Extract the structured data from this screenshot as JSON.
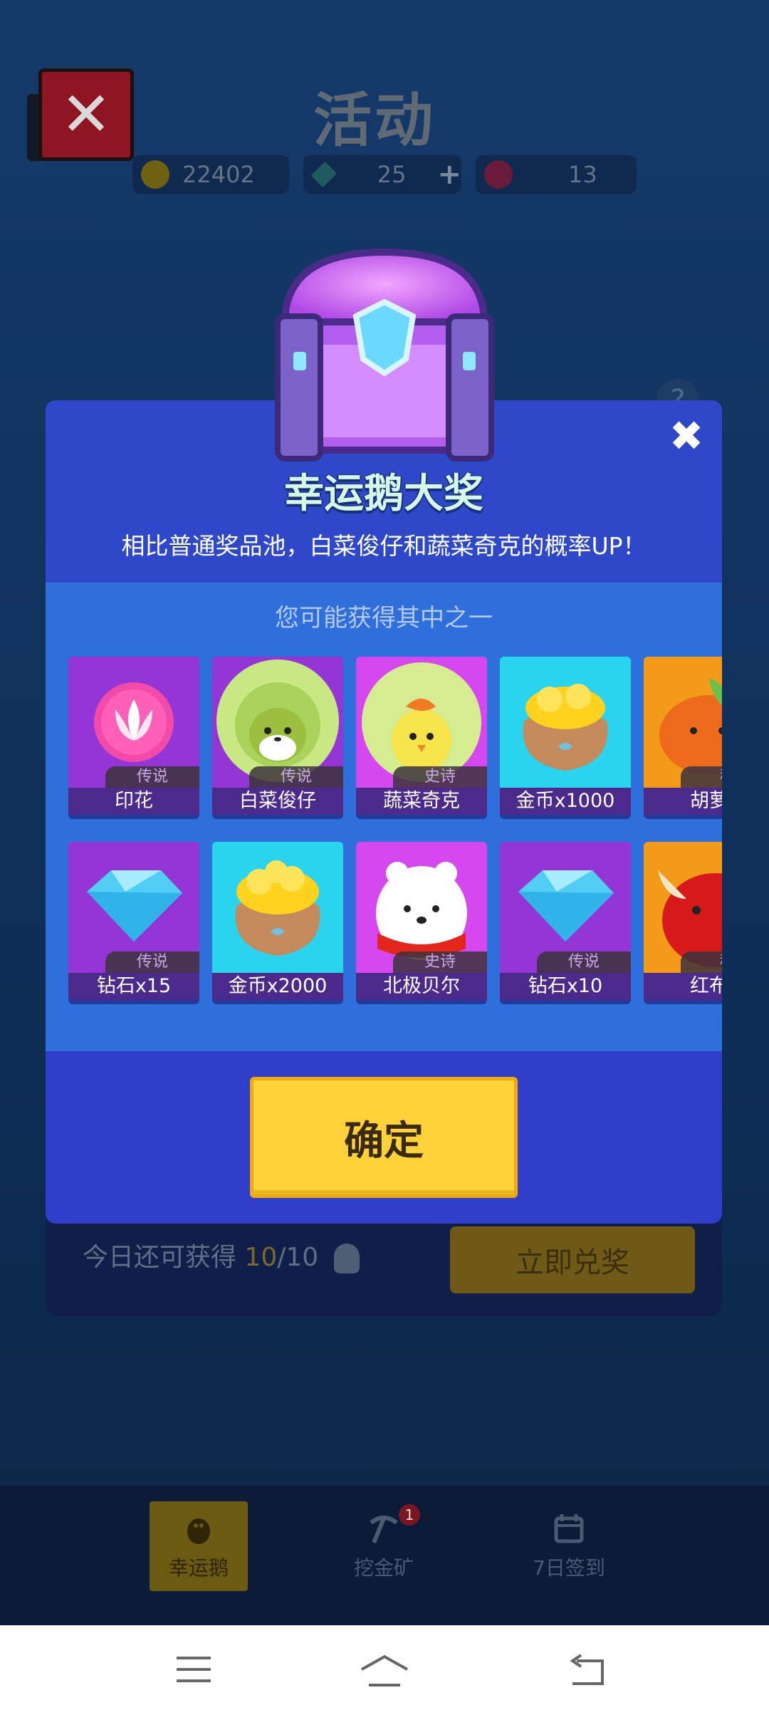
{
  "header": {
    "title": "活动"
  },
  "stats": {
    "coins": "22402",
    "diamonds": "25",
    "plus": "+",
    "tickets": "13"
  },
  "background_card": {
    "today_prefix": "今日还可获得 ",
    "today_count": "10",
    "today_suffix": "/10",
    "redeem_button": "立即兑奖"
  },
  "help_icon": "?",
  "tabbar": [
    {
      "label": "幸运鹅",
      "icon": "goose-icon",
      "active": true
    },
    {
      "label": "挖金矿",
      "icon": "pickaxe-icon",
      "badge": "1"
    },
    {
      "label": "7日签到",
      "icon": "calendar-icon"
    }
  ],
  "modal": {
    "title": "幸运鹅大奖",
    "subtitle": "相比普通奖品池，白菜俊仔和蔬菜奇克的概率UP！",
    "hint": "您可能获得其中之一",
    "close": "✖",
    "confirm_label": "确定",
    "rows": [
      [
        {
          "name": "印花",
          "rarity": "传说",
          "bg": "#9436d6",
          "icon": "flower-stamp-icon"
        },
        {
          "name": "白菜俊仔",
          "rarity": "传说",
          "bg": "#9436d6",
          "icon": "cabbage-dog-icon"
        },
        {
          "name": "蔬菜奇克",
          "rarity": "史诗",
          "bg": "#d548ef",
          "icon": "cabbage-chick-icon"
        },
        {
          "name": "金币x1000",
          "rarity": "",
          "bg": "#2ad4ee",
          "icon": "coin-bag-icon"
        },
        {
          "name": "胡萝",
          "rarity": "稀",
          "bg": "#f39a18",
          "icon": "carrot-character-icon"
        }
      ],
      [
        {
          "name": "钻石x15",
          "rarity": "传说",
          "bg": "#9436d6",
          "icon": "diamond-icon"
        },
        {
          "name": "金币x2000",
          "rarity": "",
          "bg": "#2ad4ee",
          "icon": "coin-bag-icon"
        },
        {
          "name": "北极贝尔",
          "rarity": "史诗",
          "bg": "#d548ef",
          "icon": "polar-bear-icon"
        },
        {
          "name": "钻石x10",
          "rarity": "传说",
          "bg": "#9436d6",
          "icon": "diamond-icon"
        },
        {
          "name": "红布",
          "rarity": "稀",
          "bg": "#f39a18",
          "icon": "red-bull-icon"
        }
      ]
    ]
  },
  "system_nav": [
    "menu-icon",
    "home-icon",
    "back-icon"
  ]
}
